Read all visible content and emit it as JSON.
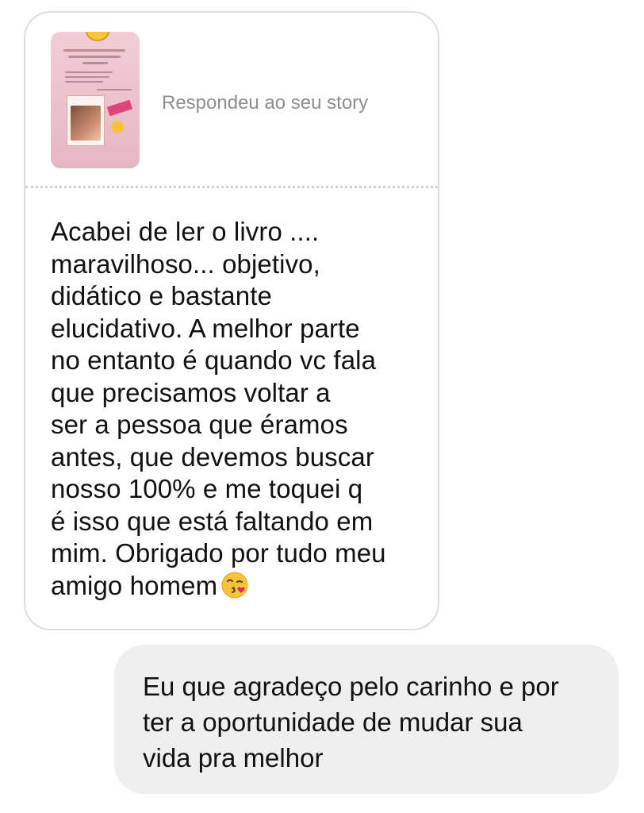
{
  "incoming_message": {
    "story_reply_label": "Respondeu ao seu story",
    "story_thumbnail": "story-thumbnail",
    "text_lines": [
      "Acabei de ler o livro ....",
      "maravilhoso... objetivo,",
      "didático e bastante",
      "elucidativo. A melhor parte",
      "no entanto é quando vc fala",
      "que precisamos voltar a",
      "ser a pessoa que éramos",
      "antes, que devemos buscar",
      "nosso 100% e me toquei q",
      "é isso que está faltando em",
      "mim. Obrigado por tudo meu",
      "amigo homem"
    ],
    "emoji": "kiss-face-icon"
  },
  "outgoing_message": {
    "text_lines": [
      "Eu que agradeço pelo carinho e por",
      "ter a oportunidade de mudar sua",
      "vida pra melhor"
    ]
  },
  "colors": {
    "incoming_border": "#dcdcdc",
    "outgoing_background": "#efefef",
    "secondary_text": "#8e8e8e",
    "primary_text": "#111111"
  }
}
